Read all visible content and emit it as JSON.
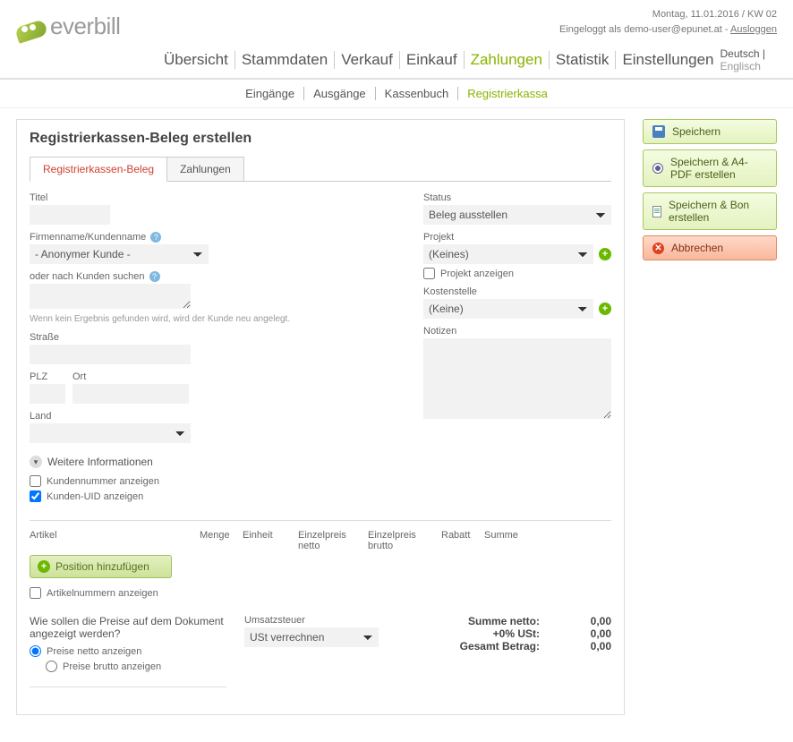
{
  "header": {
    "brand": "everbill",
    "date_line": "Montag, 11.01.2016 / KW 02",
    "login_prefix": "Eingeloggt als ",
    "login_user": "demo-user@epunet.at",
    "login_sep": " - ",
    "logout": "Ausloggen"
  },
  "nav": {
    "items": [
      "Übersicht",
      "Stammdaten",
      "Verkauf",
      "Einkauf",
      "Zahlungen",
      "Statistik",
      "Einstellungen"
    ],
    "active_index": 4,
    "lang_primary": "Deutsch",
    "lang_sep": " | ",
    "lang_secondary": "Englisch"
  },
  "subnav": {
    "items": [
      "Eingänge",
      "Ausgänge",
      "Kassenbuch",
      "Registrierkassa"
    ],
    "active_index": 3
  },
  "page": {
    "title": "Registrierkassen-Beleg erstellen"
  },
  "tabs": {
    "t0": "Registrierkassen-Beleg",
    "t1": "Zahlungen"
  },
  "left": {
    "titel_label": "Titel",
    "firm_label": "Firmenname/Kundenname",
    "firm_selected": "- Anonymer Kunde -",
    "search_label": "oder nach Kunden suchen",
    "search_note": "Wenn kein Ergebnis gefunden wird, wird der Kunde neu angelegt.",
    "street_label": "Straße",
    "plz_label": "PLZ",
    "ort_label": "Ort",
    "land_label": "Land",
    "more_info": "Weitere Informationen",
    "chk_kundennr": "Kundennummer anzeigen",
    "chk_uid": "Kunden-UID anzeigen"
  },
  "right": {
    "status_label": "Status",
    "status_selected": "Beleg ausstellen",
    "projekt_label": "Projekt",
    "projekt_selected": "(Keines)",
    "projekt_show": "Projekt anzeigen",
    "kosten_label": "Kostenstelle",
    "kosten_selected": "(Keine)",
    "notizen_label": "Notizen"
  },
  "articles": {
    "h_artikel": "Artikel",
    "h_menge": "Menge",
    "h_einheit": "Einheit",
    "h_epn": "Einzelpreis netto",
    "h_epb": "Einzelpreis brutto",
    "h_rabatt": "Rabatt",
    "h_summe": "Summe",
    "add_position": "Position hinzufügen",
    "chk_artnr": "Artikelnummern anzeigen"
  },
  "prices": {
    "question": "Wie sollen die Preise auf dem Dokument angezeigt werden?",
    "opt_netto": "Preise netto anzeigen",
    "opt_brutto": "Preise brutto anzeigen",
    "tax_label": "Umsatzsteuer",
    "tax_selected": "USt verrechnen"
  },
  "totals": {
    "netto_lbl": "Summe netto:",
    "netto_val": "0,00",
    "ust_lbl": "+0% USt:",
    "ust_val": "0,00",
    "gesamt_lbl": "Gesamt Betrag:",
    "gesamt_val": "0,00"
  },
  "sidebar": {
    "save": "Speichern",
    "save_pdf": "Speichern & A4-PDF erstellen",
    "save_bon": "Speichern & Bon erstellen",
    "cancel": "Abbrechen"
  }
}
